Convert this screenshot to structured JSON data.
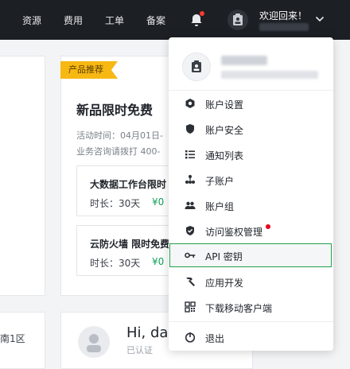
{
  "nav": {
    "items": [
      "资源",
      "费用",
      "工单",
      "备案"
    ],
    "welcome": "欢迎回来！"
  },
  "promo": {
    "tag": "产品推荐",
    "title": "新品限时免费",
    "time": "活动时间：04月01日-",
    "consult": "业务咨询请拨打 400-",
    "cards": [
      {
        "title": "大数据工作台限时",
        "duration": "时长：30天",
        "price": "¥0"
      },
      {
        "title": "云防火墙 限时免费",
        "duration": "时长：30天",
        "price": "¥0"
      }
    ]
  },
  "region": "南1区",
  "profile": {
    "greeting": "Hi, da",
    "status": "已认证"
  },
  "menu": {
    "items": [
      {
        "label": "账户设置",
        "icon": "gear-hex-icon"
      },
      {
        "label": "账户安全",
        "icon": "shield-icon"
      },
      {
        "label": "通知列表",
        "icon": "list-icon"
      },
      {
        "label": "子账户",
        "icon": "org-icon"
      },
      {
        "label": "账户组",
        "icon": "group-icon"
      },
      {
        "label": "访问鉴权管理",
        "icon": "shield-check-icon"
      },
      {
        "label": "API 密钥",
        "icon": "key-icon"
      },
      {
        "label": "应用开发",
        "icon": "hammer-icon"
      },
      {
        "label": "下载移动客户端",
        "icon": "qr-icon"
      },
      {
        "label": "退出",
        "icon": "power-icon"
      }
    ]
  },
  "colors": {
    "topbar": "#1c1f24",
    "tag": "#f7b814",
    "price": "#14a05a",
    "highlight_border": "#22a04a",
    "notify_dot": "#e5001b"
  }
}
